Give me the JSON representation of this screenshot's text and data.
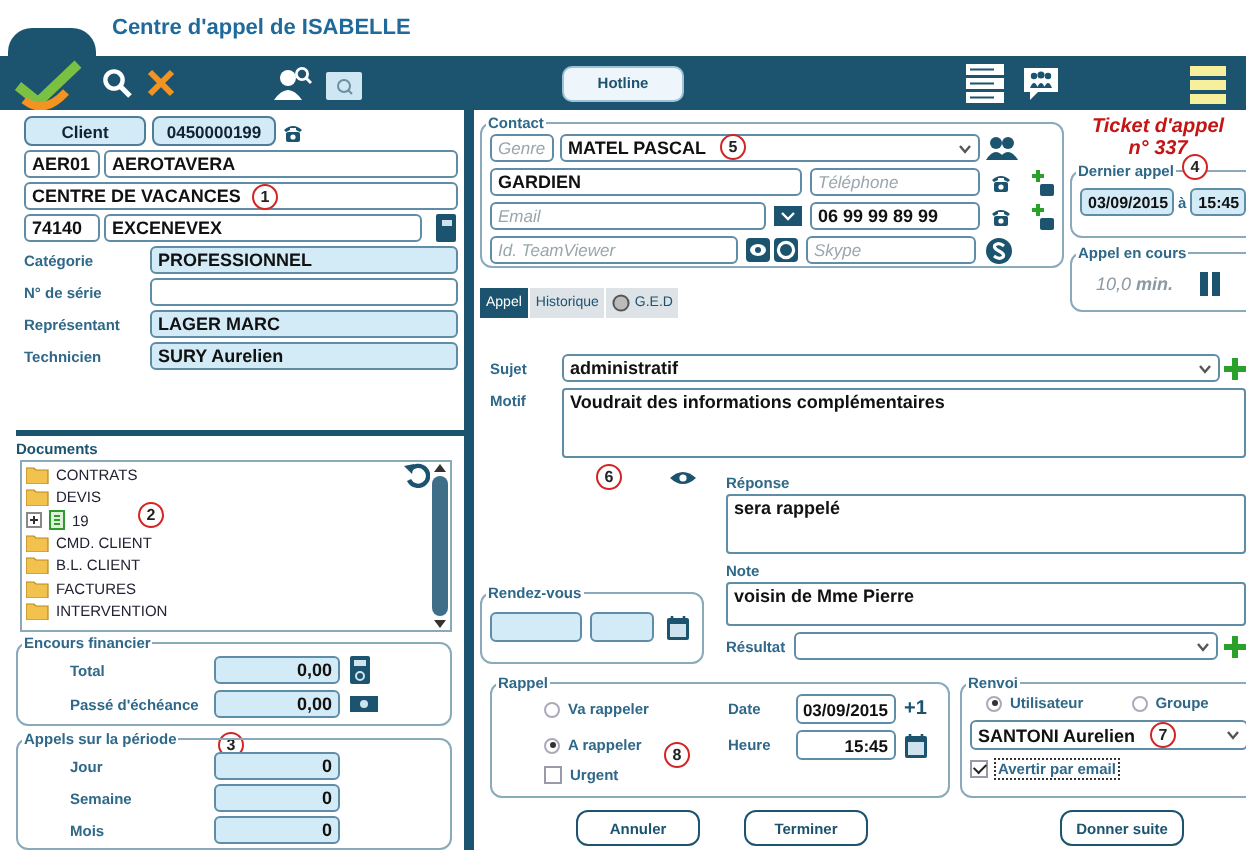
{
  "header": {
    "title": "Centre d'appel de ISABELLE"
  },
  "toolbar": {
    "hotline_button": "Hotline"
  },
  "client": {
    "button": "Client",
    "phone": "0450000199",
    "code": "AER01",
    "name": "AEROTAVERA",
    "activity": "CENTRE DE VACANCES",
    "postcode": "74140",
    "city": "EXCENEVEX",
    "marker": "1",
    "details": [
      {
        "label": "Catégorie",
        "value": "PROFESSIONNEL",
        "kind": "readonly"
      },
      {
        "label": "N° de série",
        "kind": "editable"
      },
      {
        "label": "Représentant",
        "value": "LAGER MARC",
        "kind": "readonly"
      },
      {
        "label": "Technicien",
        "value": "SURY Aurelien",
        "kind": "readonly"
      }
    ]
  },
  "documents": {
    "title": "Documents",
    "marker": "2",
    "items": [
      {
        "label": "CONTRATS",
        "kind": "folder"
      },
      {
        "label": "DEVIS",
        "kind": "folder"
      },
      {
        "label": "19",
        "kind": "file",
        "expanded": false
      },
      {
        "label": "CMD. CLIENT",
        "kind": "folder"
      },
      {
        "label": "B.L. CLIENT",
        "kind": "folder"
      },
      {
        "label": "FACTURES",
        "kind": "folder"
      },
      {
        "label": "INTERVENTION",
        "kind": "folder"
      }
    ]
  },
  "finance": {
    "title": "Encours financier",
    "marker": "3",
    "rows": [
      {
        "label": "Total",
        "value": "0,00",
        "kind": "calculator"
      },
      {
        "label": "Passé d'échéance",
        "value": "0,00",
        "kind": "money"
      }
    ]
  },
  "period_calls": {
    "title": "Appels sur la période",
    "rows": [
      {
        "label": "Jour",
        "value": "0"
      },
      {
        "label": "Semaine",
        "value": "0"
      },
      {
        "label": "Mois",
        "value": "0"
      }
    ]
  },
  "contact": {
    "title": "Contact",
    "marker": "5",
    "genre_placeholder": "Genre",
    "name": "MATEL PASCAL",
    "function": "GARDIEN",
    "phone_placeholder": "Téléphone",
    "email_placeholder": "Email",
    "mobile": "06 99 99 89 99",
    "teamviewer_placeholder": "Id. TeamViewer",
    "skype_placeholder": "Skype"
  },
  "ticket": {
    "line1": "Ticket d'appel",
    "line2": "n° 337"
  },
  "last_call": {
    "title": "Dernier appel",
    "marker": "4",
    "date": "03/09/2015",
    "separator": "à",
    "time": "15:45"
  },
  "current_call": {
    "title": "Appel en cours",
    "duration": "10,0",
    "unit": "min."
  },
  "tabs": [
    {
      "label": "Appel",
      "selected": true
    },
    {
      "label": "Historique",
      "selected": false
    },
    {
      "label": "G.E.D",
      "selected": false
    }
  ],
  "form": {
    "marker": "6",
    "subject_label": "Sujet",
    "subject": "administratif",
    "reason_label": "Motif",
    "reason": "Voudrait des informations complémentaires",
    "answer_label": "Réponse",
    "answer": "sera rappelé",
    "note_label": "Note",
    "note": "voisin de Mme Pierre",
    "result_label": "Résultat"
  },
  "appointment": {
    "title": "Rendez-vous"
  },
  "callback": {
    "title": "Rappel",
    "marker": "8",
    "options": [
      {
        "label": "Va rappeler",
        "selected": false
      },
      {
        "label": "A rappeler",
        "selected": true
      }
    ],
    "urgent": {
      "label": "Urgent",
      "checked": false
    },
    "date_label": "Date",
    "date": "03/09/2015",
    "increment": "+1",
    "time_label": "Heure",
    "time": "15:45"
  },
  "forward": {
    "title": "Renvoi",
    "marker": "7",
    "options": [
      {
        "label": "Utilisateur",
        "selected": true
      },
      {
        "label": "Groupe",
        "selected": false
      }
    ],
    "user": "SANTONI Aurelien",
    "notify": {
      "label": "Avertir par email",
      "checked": true
    }
  },
  "buttons": [
    "Annuler",
    "Terminer",
    "Donner suite"
  ]
}
